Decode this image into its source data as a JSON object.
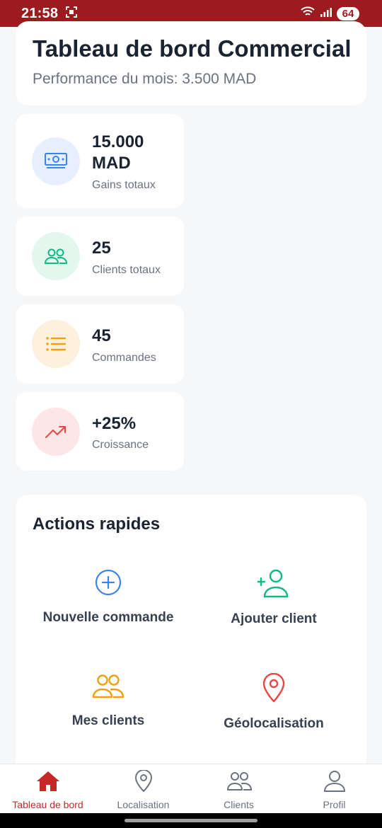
{
  "status_bar": {
    "time": "21:58",
    "battery": "64",
    "icons": [
      "screenshot-icon",
      "wifi-icon",
      "signal-icon",
      "battery-icon"
    ]
  },
  "header": {
    "title": "Tableau de bord Commercial",
    "subtitle": "Performance du mois: 3.500 MAD"
  },
  "stats": [
    {
      "value_line1": "15.000",
      "value_line2": "MAD",
      "label": "Gains totaux",
      "icon": "money-icon",
      "color": "#3b82f6",
      "bg": "#e6efff"
    },
    {
      "value": "25",
      "label": "Clients totaux",
      "icon": "users-icon",
      "color": "#10b981",
      "bg": "#e3f7ef"
    },
    {
      "value": "45",
      "label": "Commandes",
      "icon": "list-icon",
      "color": "#f59e0b",
      "bg": "#fdf0dc"
    },
    {
      "value": "+25%",
      "label": "Croissance",
      "icon": "trending-up-icon",
      "color": "#ef4444",
      "bg": "#fde6e6"
    }
  ],
  "quick_actions": {
    "title": "Actions rapides",
    "items": [
      {
        "label": "Nouvelle commande",
        "icon": "plus-circle-icon",
        "color": "#3b82f6"
      },
      {
        "label": "Ajouter client",
        "icon": "user-plus-icon",
        "color": "#10b981"
      },
      {
        "label": "Mes clients",
        "icon": "users-icon",
        "color": "#f59e0b"
      },
      {
        "label": "Géolocalisation",
        "icon": "map-pin-icon",
        "color": "#ef4444"
      }
    ]
  },
  "bottom_nav": {
    "active_color": "#c62828",
    "items": [
      {
        "label": "Tableau de bord",
        "icon": "home-icon",
        "active": true
      },
      {
        "label": "Localisation",
        "icon": "map-pin-icon",
        "active": false
      },
      {
        "label": "Clients",
        "icon": "users-icon",
        "active": false
      },
      {
        "label": "Profil",
        "icon": "user-icon",
        "active": false
      }
    ]
  }
}
